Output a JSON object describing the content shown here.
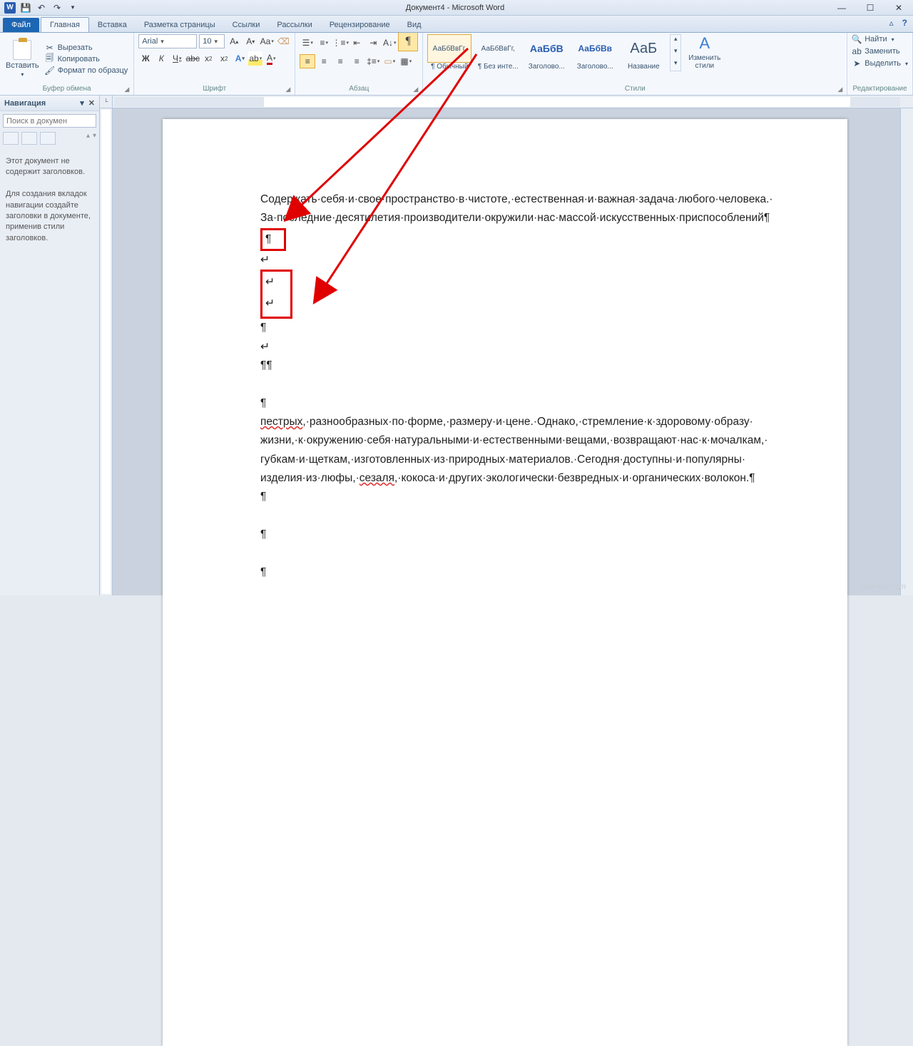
{
  "title": "Документ4 - Microsoft Word",
  "tabs": {
    "file": "Файл",
    "home": "Главная",
    "insert": "Вставка",
    "layout": "Разметка страницы",
    "refs": "Ссылки",
    "mail": "Рассылки",
    "review": "Рецензирование",
    "view": "Вид"
  },
  "clipboard": {
    "paste": "Вставить",
    "cut": "Вырезать",
    "copy": "Копировать",
    "painter": "Формат по образцу",
    "label": "Буфер обмена"
  },
  "font": {
    "name": "Arial",
    "size": "10",
    "label": "Шрифт"
  },
  "para": {
    "label": "Абзац"
  },
  "styles": {
    "label": "Стили",
    "change": "Изменить\nстили",
    "items": [
      {
        "prev": "АаБбВвГг,",
        "name": "¶ Обычный"
      },
      {
        "prev": "АаБбВвГг,",
        "name": "¶ Без инте..."
      },
      {
        "prev": "АаБбВ",
        "name": "Заголово..."
      },
      {
        "prev": "АаБбВв",
        "name": "Заголово..."
      },
      {
        "prev": "АаБ",
        "name": "Название"
      }
    ]
  },
  "editing": {
    "find": "Найти",
    "replace": "Заменить",
    "select": "Выделить",
    "label": "Редактирование"
  },
  "nav": {
    "title": "Навигация",
    "placeholder": "Поиск в докумен",
    "msg1": "Этот документ не содержит заголовков.",
    "msg2": "Для создания вкладок навигации создайте заголовки в документе, применив стили заголовков."
  },
  "doc": {
    "p1": "Содержать·себя·и·свое·пространство·в·чистоте,·естественная·и·важная·задача·любого·человека.·",
    "p2": "За·последние·десятилетия·производители·окружили·нас·массой·искусственных·приспособлений¶",
    "pil": "¶",
    "lb": "↵",
    "p3a": "пестрых",
    "p3b": ",·разнообразных·по·форме,·размеру·и·цене.·Однако,·стремление·к·здоровому·образу·",
    "p4": "жизни,·к·окружению·себя·натуральными·и·естественными·вещами,·возвращают·нас·к·мочалкам,·",
    "p5": "губкам·и·щеткам,·изготовленных·из·природных·материалов.·Сегодня·доступны·и·популярны·",
    "p6a": "изделия·из·люфы,·",
    "p6b": "сезаля",
    "p6c": ",·кокоса·и·других·экологически·безвредных·и·органических·волокон.¶"
  },
  "watermark": "user-life.com"
}
